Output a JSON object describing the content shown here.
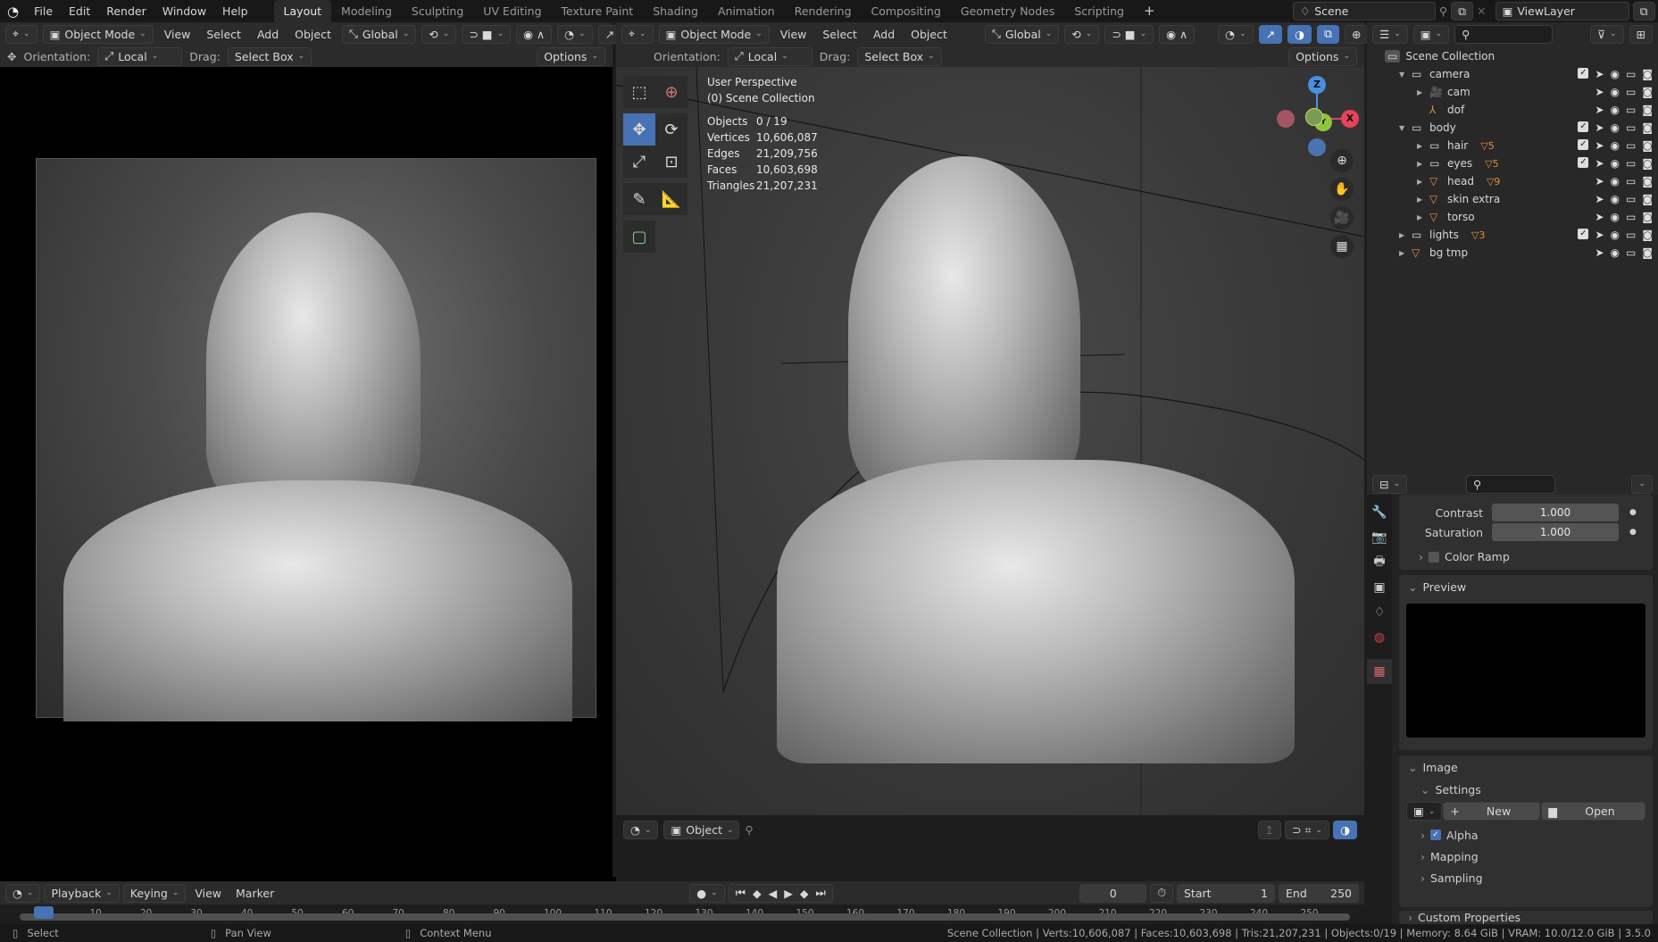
{
  "topbar": {
    "menus": [
      "File",
      "Edit",
      "Render",
      "Window",
      "Help"
    ],
    "workspaces": [
      "Layout",
      "Modeling",
      "Sculpting",
      "UV Editing",
      "Texture Paint",
      "Shading",
      "Animation",
      "Rendering",
      "Compositing",
      "Geometry Nodes",
      "Scripting"
    ],
    "active_workspace": "Layout",
    "add_workspace": "+",
    "scene": "Scene",
    "view_layer": "ViewLayer"
  },
  "left_editor": {
    "mode": "Object Mode",
    "menus": [
      "View",
      "Select",
      "Add",
      "Object"
    ],
    "transform_orientation": "Global",
    "orientation_label": "Orientation:",
    "orientation_value": "Local",
    "drag_label": "Drag:",
    "drag_value": "Select Box",
    "options": "Options"
  },
  "viewport": {
    "mode": "Object Mode",
    "menus": [
      "View",
      "Select",
      "Add",
      "Object"
    ],
    "transform_orientation": "Global",
    "orientation_label": "Orientation:",
    "orientation_value": "Local",
    "drag_label": "Drag:",
    "drag_value": "Select Box",
    "options": "Options",
    "perspective": "User Perspective",
    "collection": "(0) Scene Collection",
    "stats": [
      {
        "label": "Objects",
        "value": "0 / 19"
      },
      {
        "label": "Vertices",
        "value": "10,606,087"
      },
      {
        "label": "Edges",
        "value": "21,209,756"
      },
      {
        "label": "Faces",
        "value": "10,603,698"
      },
      {
        "label": "Triangles",
        "value": "21,207,231"
      }
    ],
    "gizmo_axes": {
      "x": "X",
      "y": "Y",
      "z": "Z"
    },
    "footer_mode": "Object",
    "colors": {
      "active_tool": "#4772b3",
      "x_axis": "#e6425d",
      "y_axis": "#8cc63f",
      "z_axis": "#4a8fe0"
    }
  },
  "outliner": {
    "root": "Scene Collection",
    "items": [
      {
        "name": "camera",
        "type": "collection",
        "depth": 1,
        "expanded": true,
        "checkbox": true
      },
      {
        "name": "cam",
        "type": "camera",
        "depth": 2
      },
      {
        "name": "dof",
        "type": "empty",
        "depth": 2
      },
      {
        "name": "body",
        "type": "collection",
        "depth": 1,
        "expanded": true,
        "checkbox": true
      },
      {
        "name": "hair",
        "type": "collection",
        "depth": 2,
        "checkbox": true,
        "badge": "5"
      },
      {
        "name": "eyes",
        "type": "collection",
        "depth": 2,
        "checkbox": true,
        "badge": "5"
      },
      {
        "name": "head",
        "type": "mesh",
        "depth": 2,
        "badge": "9"
      },
      {
        "name": "skin extra",
        "type": "mesh",
        "depth": 2
      },
      {
        "name": "torso",
        "type": "mesh",
        "depth": 2
      },
      {
        "name": "lights",
        "type": "collection",
        "depth": 1,
        "checkbox": true,
        "badge": "3"
      },
      {
        "name": "bg tmp",
        "type": "mesh",
        "depth": 1
      }
    ]
  },
  "properties": {
    "fields": [
      {
        "label": "Contrast",
        "value": "1.000"
      },
      {
        "label": "Saturation",
        "value": "1.000"
      }
    ],
    "color_ramp": "Color Ramp",
    "preview": "Preview",
    "image": "Image",
    "settings": "Settings",
    "new": "New",
    "open": "Open",
    "alpha": "Alpha",
    "alpha_checked": true,
    "mapping": "Mapping",
    "sampling": "Sampling",
    "custom_properties": "Custom Properties"
  },
  "timeline": {
    "menus": [
      "Playback",
      "Keying",
      "View",
      "Marker"
    ],
    "current_frame": "0",
    "start_label": "Start",
    "start": "1",
    "end_label": "End",
    "end": "250",
    "ticks": [
      "0",
      "10",
      "20",
      "30",
      "40",
      "50",
      "60",
      "70",
      "80",
      "90",
      "100",
      "110",
      "120",
      "130",
      "140",
      "150",
      "160",
      "170",
      "180",
      "190",
      "200",
      "210",
      "220",
      "230",
      "240",
      "250"
    ]
  },
  "statusbar": {
    "hints": [
      "Select",
      "Pan View",
      "Context Menu"
    ],
    "info": "Scene Collection | Verts:10,606,087 | Faces:10,603,698 | Tris:21,207,231 | Objects:0/19 | Memory: 8.64 GiB | VRAM: 10.0/12.0 GiB | 3.5.0"
  }
}
